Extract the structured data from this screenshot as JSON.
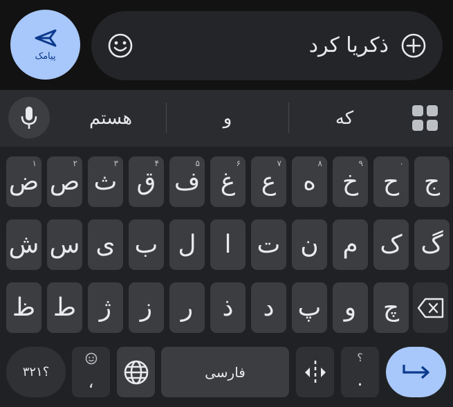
{
  "compose": {
    "send_label": "پیامک",
    "message_text": "ذکریا کرد"
  },
  "suggestions": [
    "هستم",
    "و",
    "که"
  ],
  "rows": [
    {
      "keys": [
        {
          "char": "ض",
          "hint": "۱"
        },
        {
          "char": "ص",
          "hint": "۲"
        },
        {
          "char": "ث",
          "hint": "۳"
        },
        {
          "char": "ق",
          "hint": "۴"
        },
        {
          "char": "ف",
          "hint": "۵"
        },
        {
          "char": "غ",
          "hint": "۶"
        },
        {
          "char": "ع",
          "hint": "۷"
        },
        {
          "char": "ه",
          "hint": "۸"
        },
        {
          "char": "خ",
          "hint": "۹"
        },
        {
          "char": "ح",
          "hint": "۰"
        },
        {
          "char": "ج",
          "hint": ""
        }
      ]
    },
    {
      "keys": [
        {
          "char": "ش",
          "hint": ""
        },
        {
          "char": "س",
          "hint": ""
        },
        {
          "char": "ی",
          "hint": ""
        },
        {
          "char": "ب",
          "hint": ""
        },
        {
          "char": "ل",
          "hint": ""
        },
        {
          "char": "ا",
          "hint": ""
        },
        {
          "char": "ت",
          "hint": ""
        },
        {
          "char": "ن",
          "hint": ""
        },
        {
          "char": "م",
          "hint": ""
        },
        {
          "char": "ک",
          "hint": ""
        },
        {
          "char": "گ",
          "hint": ""
        }
      ]
    },
    {
      "keys": [
        {
          "char": "ظ",
          "hint": ""
        },
        {
          "char": "ط",
          "hint": ""
        },
        {
          "char": "ژ",
          "hint": ""
        },
        {
          "char": "ز",
          "hint": ""
        },
        {
          "char": "ر",
          "hint": ""
        },
        {
          "char": "ذ",
          "hint": ""
        },
        {
          "char": "د",
          "hint": ""
        },
        {
          "char": "پ",
          "hint": ""
        },
        {
          "char": "و",
          "hint": ""
        },
        {
          "char": "چ",
          "hint": ""
        }
      ]
    }
  ],
  "bottom_row": {
    "symbols_label": "؟۳۲۱",
    "comma_label": "،",
    "space_label": "فارسی",
    "period_label": ".",
    "period_hint": "؟"
  },
  "icons": {
    "send": "send-arrow-icon",
    "emoji": "emoji-icon",
    "plus": "add-circle-icon",
    "mic": "microphone-icon",
    "grid": "apps-grid-icon",
    "backspace": "backspace-icon",
    "globe": "globe-icon",
    "cursor": "cursor-move-icon",
    "enter": "enter-arrow-icon"
  },
  "colors": {
    "accent": "#a8c7fa",
    "key_bg": "#3c3d40",
    "keyboard_bg": "#202124",
    "compose_bg": "#121212"
  }
}
